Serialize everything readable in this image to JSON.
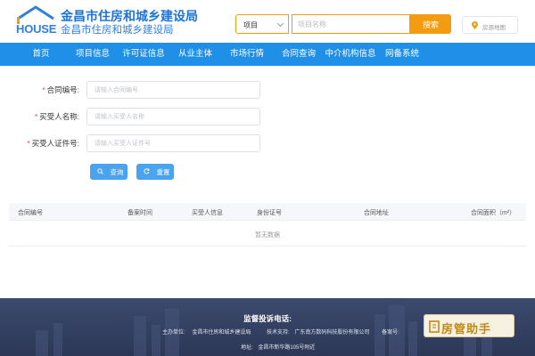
{
  "header": {
    "logo_text": "HOUSE",
    "title": "金昌市住房和城乡建设局",
    "subtitle": "金昌市住房和城乡建设局",
    "search": {
      "category": "项目",
      "placeholder": "项目名称",
      "button_label": "搜索"
    },
    "map_label": "房源地图"
  },
  "nav": {
    "items": [
      "首页",
      "项目信息",
      "许可证信息",
      "从业主体",
      "市场行情",
      "合同查询",
      "中介机构信息",
      "网备系统"
    ]
  },
  "form": {
    "fields": [
      {
        "label": "合同编号:",
        "placeholder": "请输入合同编号",
        "required": true
      },
      {
        "label": "买受人名称:",
        "placeholder": "请输入买受人名称",
        "required": true
      },
      {
        "label": "买受人证件号:",
        "placeholder": "请输入买受人证件号",
        "required": true
      }
    ],
    "query_label": "查询",
    "reset_label": "重置"
  },
  "table": {
    "columns": [
      "合同编号",
      "备案时间",
      "买受人信息",
      "身份证号",
      "合同地址",
      "合同面积（m²）"
    ],
    "empty_text": "暂无数据"
  },
  "footer": {
    "title": "监督投诉电话:",
    "sponsor_label": "主办单位:",
    "sponsor": "金昌市住房和城乡建设局",
    "tech_label": "技术支持:",
    "tech": "广东南方数码科技股份有限公司",
    "icp_label": "备案号:",
    "address_label": "地址:",
    "address": "金昌市新华路105号附近"
  },
  "badge": {
    "text": "房管助手"
  },
  "colors": {
    "brand_blue": "#1f8fe8",
    "orange": "#f39c12",
    "footer_bg": "#34405f"
  }
}
